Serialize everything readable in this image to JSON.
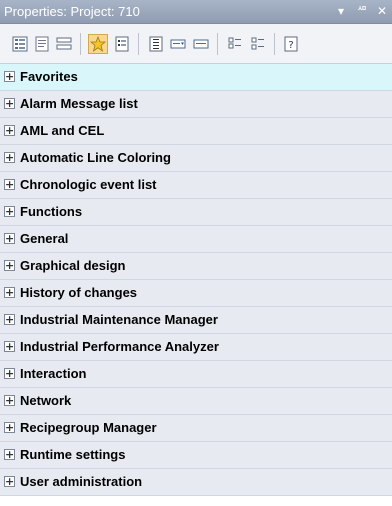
{
  "window": {
    "title": "Properties: Project: 710",
    "controls": [
      {
        "name": "dropdown-arrow-icon",
        "glyph": "▾"
      },
      {
        "name": "pin-icon",
        "glyph": "ጱ"
      },
      {
        "name": "close-icon",
        "glyph": "✕"
      }
    ]
  },
  "toolbar": {
    "buttons": [
      {
        "name": "categorized-view-icon",
        "active": false
      },
      {
        "name": "alphabetical-view-icon",
        "active": false
      },
      {
        "name": "grouped-view-icon",
        "active": false
      },
      {
        "name": "favorites-star-icon",
        "active": true
      },
      {
        "name": "properties-page-icon",
        "active": false
      },
      {
        "name": "property-list-icon",
        "active": false
      },
      {
        "name": "dropdown-field-icon",
        "active": false
      },
      {
        "name": "expand-field-icon",
        "active": false
      },
      {
        "name": "expand-all-icon",
        "active": false
      },
      {
        "name": "collapse-all-icon",
        "active": false
      },
      {
        "name": "help-icon",
        "active": false
      }
    ]
  },
  "properties": {
    "expander_glyph": "+",
    "categories": [
      "Favorites",
      "Alarm Message list",
      "AML and CEL",
      "Automatic Line Coloring",
      "Chronologic event list",
      "Functions",
      "General",
      "Graphical design",
      "History of changes",
      "Industrial Maintenance Manager",
      "Industrial Performance Analyzer",
      "Interaction",
      "Network",
      "Recipegroup Manager",
      "Runtime settings",
      "User administration"
    ]
  },
  "colors": {
    "titlebar": "#9aa6b9",
    "row_background": "#e7ebf1",
    "favorites_row_background": "#d9f7fa",
    "active_button": "#f8d88e"
  }
}
